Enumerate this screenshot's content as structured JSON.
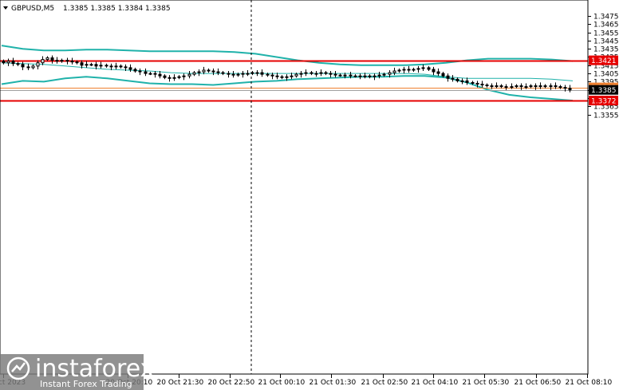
{
  "header": {
    "symbol": "GBPUSD,M5",
    "quote": "1.3385 1.3385 1.3384 1.3385"
  },
  "watermark": {
    "brand": "instaforex",
    "tagline": "Instant Forex Trading"
  },
  "colors": {
    "candle": "#000000",
    "band_outer": "#20b2aa",
    "band_mid": "#20b2aa",
    "level_red": "#e60000",
    "level_orange": "#f08030",
    "bid_line": "#a0a0a0"
  },
  "chart_data": {
    "type": "candlestick",
    "symbol": "GBPUSD",
    "timeframe": "M5",
    "ylim": [
      1.335,
      1.348
    ],
    "yticks": [
      "1.3475",
      "1.3465",
      "1.3455",
      "1.3445",
      "1.3435",
      "1.3425",
      "1.3415",
      "1.3405",
      "1.3395",
      "1.3385",
      "1.3375",
      "1.3365",
      "1.3355"
    ],
    "xticks": [
      "20 Oct 2023",
      "20 Oct 20:10",
      "20 Oct 21:30",
      "20 Oct 22:50",
      "21 Oct 00:10",
      "21 Oct 01:30",
      "21 Oct 02:50",
      "21 Oct 04:10",
      "21 Oct 05:30",
      "21 Oct 06:50",
      "21 Oct 08:10"
    ],
    "levels": [
      {
        "price": 1.3421,
        "label": "1.3421",
        "style": "red"
      },
      {
        "price": 1.3388,
        "label": "1.3388",
        "style": "orange"
      },
      {
        "price": 1.3372,
        "label": "1.3372",
        "style": "red"
      }
    ],
    "current_price": {
      "price": 1.3385,
      "label": "1.3385"
    },
    "close": [
      1.3418,
      1.342,
      1.3417,
      1.3416,
      1.3413,
      1.3412,
      1.3414,
      1.3418,
      1.3422,
      1.3424,
      1.3421,
      1.342,
      1.3421,
      1.342,
      1.3419,
      1.3418,
      1.3415,
      1.3416,
      1.3416,
      1.3414,
      1.3415,
      1.3414,
      1.3413,
      1.3414,
      1.3413,
      1.3412,
      1.341,
      1.3408,
      1.3407,
      1.3405,
      1.3405,
      1.3404,
      1.3402,
      1.34,
      1.3399,
      1.34,
      1.3401,
      1.3402,
      1.3404,
      1.3406,
      1.3407,
      1.3409,
      1.3408,
      1.3407,
      1.3406,
      1.3405,
      1.3404,
      1.3403,
      1.3404,
      1.3405,
      1.3405,
      1.3406,
      1.3406,
      1.3404,
      1.3403,
      1.3402,
      1.3401,
      1.34,
      1.3401,
      1.3402,
      1.3404,
      1.3405,
      1.3406,
      1.3405,
      1.3405,
      1.3406,
      1.3405,
      1.3404,
      1.3403,
      1.3403,
      1.3403,
      1.3402,
      1.3402,
      1.3402,
      1.3402,
      1.3401,
      1.3402,
      1.3403,
      1.3404,
      1.3406,
      1.3408,
      1.3409,
      1.341,
      1.3409,
      1.341,
      1.3411,
      1.3412,
      1.341,
      1.3407,
      1.3405,
      1.3402,
      1.3399,
      1.3398,
      1.3396,
      1.3396,
      1.3394,
      1.3393,
      1.3392,
      1.3391,
      1.339,
      1.339,
      1.339,
      1.3389,
      1.3389,
      1.3389,
      1.339,
      1.3389,
      1.3389,
      1.339,
      1.3389,
      1.339,
      1.3389,
      1.339,
      1.3389,
      1.3388,
      1.3387,
      1.3385
    ],
    "bands": {
      "upper": [
        1.3439,
        1.3435,
        1.3433,
        1.3433,
        1.3434,
        1.3434,
        1.3433,
        1.3432,
        1.3432,
        1.3432,
        1.3432,
        1.3431,
        1.3429,
        1.3425,
        1.3421,
        1.3418,
        1.3416,
        1.3415,
        1.3415,
        1.3415,
        1.3416,
        1.3418,
        1.3421,
        1.3423,
        1.3423,
        1.3423,
        1.3422,
        1.342
      ],
      "middle": [
        1.3418,
        1.3417,
        1.3416,
        1.3414,
        1.3412,
        1.341,
        1.3409,
        1.3408,
        1.3406,
        1.3405,
        1.3405,
        1.3405,
        1.3405,
        1.3405,
        1.3405,
        1.3405,
        1.3405,
        1.3405,
        1.3405,
        1.3405,
        1.3404,
        1.3401,
        1.3399,
        1.3399,
        1.3399,
        1.3399,
        1.3398,
        1.3396
      ],
      "lower": [
        1.3392,
        1.3396,
        1.3395,
        1.3399,
        1.3401,
        1.3399,
        1.3396,
        1.3393,
        1.3392,
        1.3392,
        1.3391,
        1.3393,
        1.3395,
        1.3396,
        1.3398,
        1.3399,
        1.34,
        1.3401,
        1.3401,
        1.3402,
        1.3402,
        1.34,
        1.3394,
        1.3385,
        1.3379,
        1.3376,
        1.3374,
        1.3372
      ]
    }
  }
}
